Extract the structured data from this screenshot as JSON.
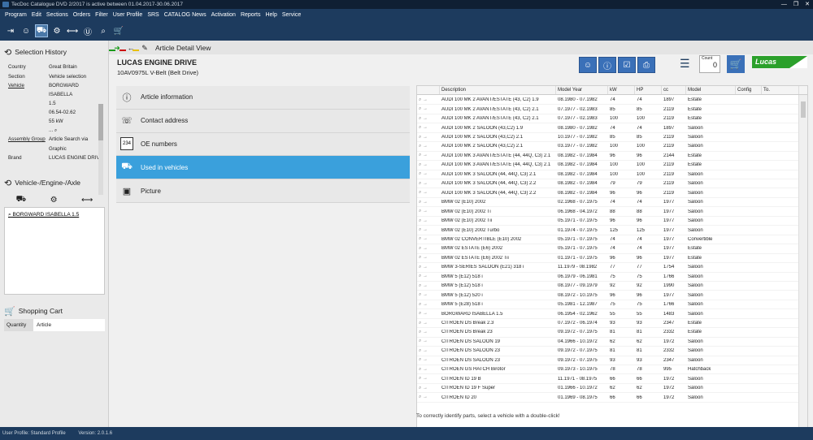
{
  "window": {
    "title": "TecDoc Catalogue DVD   2/2017 is active between 01.04.2017-30.06.2017",
    "controls": [
      "—",
      "❐",
      "✕"
    ]
  },
  "menu": [
    "Program",
    "Edit",
    "Sections",
    "Orders",
    "Filter",
    "User Profile",
    "SRS",
    "CATALOG News",
    "Activation",
    "Reports",
    "Help",
    "Service"
  ],
  "toolbar": {
    "icons": [
      "exit-icon",
      "user-icon",
      "vehicle-search-icon",
      "engine-icon",
      "axle-icon",
      "brand-icon",
      "search-icon",
      "cart-icon"
    ]
  },
  "left": {
    "selection_history_title": "Selection History",
    "country_label": "Country",
    "country_value": "Great Britain",
    "section_label": "Section",
    "section_value": "Vehicle selection",
    "vehicle_label": "Vehicle",
    "vehicle_lines": [
      "BORGWARD",
      "ISABELLA",
      "1.5",
      "06.54-02.62",
      "55 kW",
      "..."
    ],
    "assembly_label": "Assembly Group",
    "assembly_value": "Article Search via",
    "assembly_value2": "Graphic",
    "brand_label": "Brand",
    "brand_value": "LUCAS ENGINE DRIVE",
    "veh_section_title": "Vehicle-/Engine-/Axle",
    "veh_item": "BORGWARD ISABELLA 1.5",
    "cart_title": "Shopping Cart",
    "qty_label": "Quantity",
    "article_label": "Article"
  },
  "main": {
    "view_title": "Article Detail View",
    "brand": "LUCAS ENGINE DRIVE",
    "article": "10AV0975L V-Belt (Belt Drive)",
    "count_label": "Count",
    "count_value": "0",
    "logo_text": "Lucas",
    "tabs": [
      {
        "label": "Article information",
        "icon": "info-icon"
      },
      {
        "label": "Contact address",
        "icon": "contact-icon"
      },
      {
        "label": "OE numbers",
        "icon": "oe-numbers-icon",
        "icon_text": "234"
      },
      {
        "label": "Used in vehicles",
        "icon": "car-icon"
      },
      {
        "label": "Picture",
        "icon": "picture-icon"
      }
    ],
    "hint": "To correctly identify parts, select a vehicle with a double-click!"
  },
  "table": {
    "headers": [
      "Description",
      "Model Year",
      "kW",
      "HP",
      "cc",
      "Model",
      "Config",
      "To."
    ],
    "rows": [
      [
        "AUDI 100 MK 2 AVANT/ESTATE (43, C2) 1.9",
        "08.1980 - 07.1982",
        "74",
        "74",
        "1897",
        "Estate"
      ],
      [
        "AUDI 100 MK 2 AVANT/ESTATE (43, C2) 2.1",
        "07.1977 - 02.1983",
        "85",
        "85",
        "2119",
        "Estate"
      ],
      [
        "AUDI 100 MK 2 AVANT/ESTATE (43, C2) 2.1",
        "07.1977 - 02.1983",
        "100",
        "100",
        "2119",
        "Estate"
      ],
      [
        "AUDI 100 MK 2 SALOON (43,C2) 1.9",
        "08.1980 - 07.1982",
        "74",
        "74",
        "1897",
        "Saloon"
      ],
      [
        "AUDI 100 MK 2 SALOON (43,C2) 2.1",
        "10.1977 - 07.1982",
        "85",
        "85",
        "2119",
        "Saloon"
      ],
      [
        "AUDI 100 MK 2 SALOON (43,C2) 2.1",
        "03.1977 - 07.1982",
        "100",
        "100",
        "2119",
        "Saloon"
      ],
      [
        "AUDI 100 MK 3 AVANT/ESTATE (44, 44Q, C3) 2.1",
        "08.1982 - 07.1984",
        "96",
        "96",
        "2144",
        "Estate"
      ],
      [
        "AUDI 100 MK 3 AVANT/ESTATE (44, 44Q, C3) 2.1",
        "08.1982 - 07.1984",
        "100",
        "100",
        "2119",
        "Estate"
      ],
      [
        "AUDI 100 MK 3 SALOON (44, 44Q, C3) 2.1",
        "08.1982 - 07.1984",
        "100",
        "100",
        "2119",
        "Saloon"
      ],
      [
        "AUDI 100 MK 3 SALOON (44, 44Q, C3) 2.2",
        "08.1982 - 07.1984",
        "79",
        "79",
        "2119",
        "Saloon"
      ],
      [
        "AUDI 100 MK 3 SALOON (44, 44Q, C3) 2.2",
        "08.1982 - 07.1984",
        "96",
        "96",
        "2119",
        "Saloon"
      ],
      [
        "BMW 02 (E10) 2002",
        "02.1968 - 07.1975",
        "74",
        "74",
        "1977",
        "Saloon"
      ],
      [
        "BMW 02 (E10) 2002 Ti",
        "06.1968 - 04.1972",
        "88",
        "88",
        "1977",
        "Saloon"
      ],
      [
        "BMW 02 (E10) 2002 Tii",
        "05.1971 - 07.1975",
        "96",
        "96",
        "1977",
        "Saloon"
      ],
      [
        "BMW 02 (E10) 2002 Turbo",
        "01.1974 - 07.1975",
        "125",
        "125",
        "1977",
        "Saloon"
      ],
      [
        "BMW 02 CONVERTIBLE (E10) 2002",
        "05.1971 - 07.1975",
        "74",
        "74",
        "1977",
        "Convertible"
      ],
      [
        "BMW 02 ESTATE (E6) 2002",
        "05.1971 - 07.1975",
        "74",
        "74",
        "1977",
        "Estate"
      ],
      [
        "BMW 02 ESTATE (E6) 2002 Tii",
        "01.1971 - 07.1975",
        "96",
        "96",
        "1977",
        "Estate"
      ],
      [
        "BMW 3-SERIES SALOON (E21) 318 i",
        "11.1979 - 08.1982",
        "77",
        "77",
        "1754",
        "Saloon"
      ],
      [
        "BMW 5 (E12) 518 i",
        "06.1979 - 06.1981",
        "75",
        "75",
        "1766",
        "Saloon"
      ],
      [
        "BMW 5 (E12) 518 i",
        "08.1977 - 09.1979",
        "92",
        "92",
        "1990",
        "Saloon"
      ],
      [
        "BMW 5 (E12) 520 i",
        "08.1972 - 10.1975",
        "96",
        "96",
        "1977",
        "Saloon"
      ],
      [
        "BMW 5 (E28) 518 i",
        "05.1981 - 12.1987",
        "75",
        "75",
        "1766",
        "Saloon"
      ],
      [
        "BORGWARD ISABELLA 1.5",
        "06.1954 - 02.1962",
        "55",
        "55",
        "1483",
        "Saloon"
      ],
      [
        "CITROËN DS Break 2.3",
        "07.1972 - 06.1974",
        "93",
        "93",
        "2347",
        "Estate"
      ],
      [
        "CITROËN DS Break 23",
        "09.1972 - 07.1975",
        "81",
        "81",
        "2332",
        "Estate"
      ],
      [
        "CITROËN DS SALOON 19",
        "04.1966 - 10.1972",
        "62",
        "62",
        "1972",
        "Saloon"
      ],
      [
        "CITROËN DS SALOON 23",
        "09.1972 - 07.1975",
        "81",
        "81",
        "2332",
        "Saloon"
      ],
      [
        "CITROËN DS SALOON 23",
        "09.1972 - 07.1975",
        "93",
        "93",
        "2347",
        "Saloon"
      ],
      [
        "CITROËN GS HATCH Birotor",
        "09.1973 - 10.1975",
        "78",
        "78",
        "995",
        "Hatchback"
      ],
      [
        "CITROËN ID 19 B",
        "11.1971 - 08.1975",
        "66",
        "66",
        "1972",
        "Saloon"
      ],
      [
        "CITROËN ID 19 F Super",
        "01.1966 - 10.1972",
        "62",
        "62",
        "1972",
        "Saloon"
      ],
      [
        "CITROËN ID 20",
        "01.1969 - 08.1975",
        "66",
        "66",
        "1972",
        "Saloon"
      ]
    ]
  },
  "statusbar": {
    "profile": "User Profile: Standard Profile",
    "version": "Version: 2.0.1.6"
  }
}
